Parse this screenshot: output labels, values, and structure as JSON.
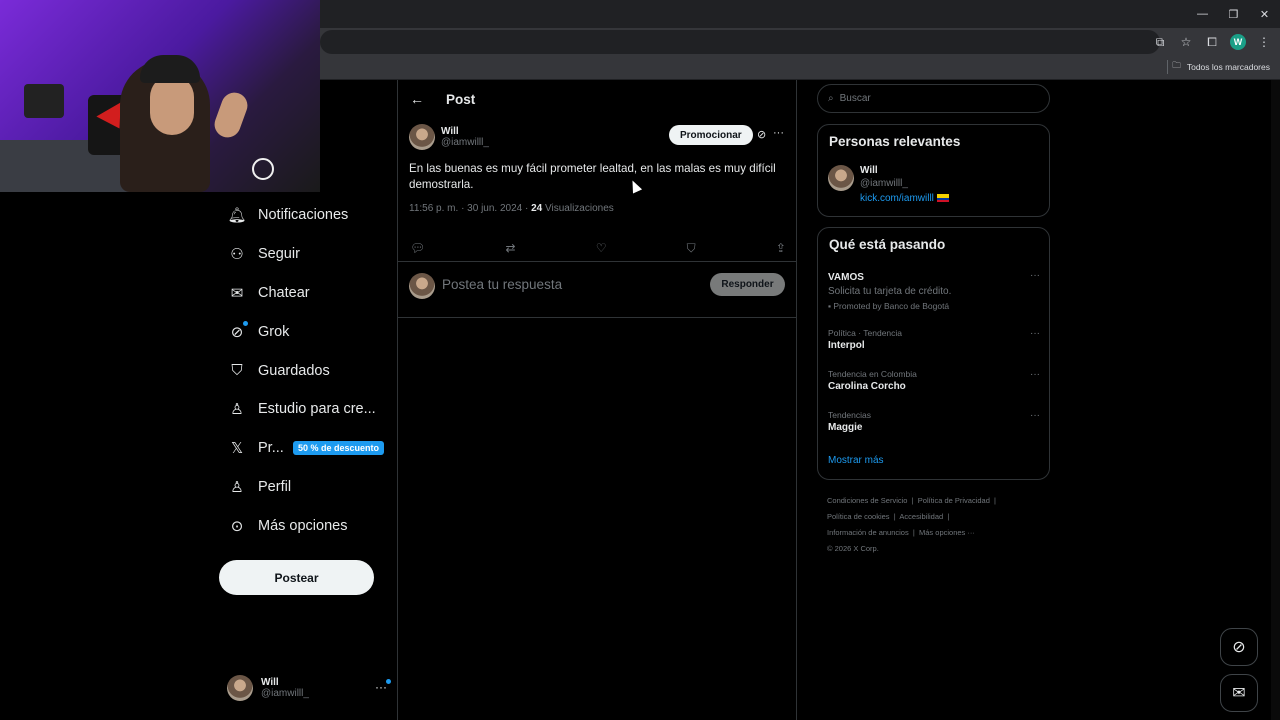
{
  "browser": {
    "profile_initial": "W",
    "bookmarks_all": "Todos los marcadores"
  },
  "nav": {
    "items": [
      {
        "label": "Notificaciones",
        "icon": "bell-icon"
      },
      {
        "label": "Seguir",
        "icon": "follow-icon"
      },
      {
        "label": "Chatear",
        "icon": "mail-icon"
      },
      {
        "label": "Grok",
        "icon": "grok-icon"
      },
      {
        "label": "Guardados",
        "icon": "bookmark-icon"
      },
      {
        "label": "Estudio para cre...",
        "icon": "studio-icon"
      },
      {
        "label": "Pr...",
        "icon": "x-logo-icon",
        "badge": "50 % de descuento"
      },
      {
        "label": "Perfil",
        "icon": "profile-icon"
      },
      {
        "label": "Más opciones",
        "icon": "more-icon"
      }
    ],
    "post_button": "Postear",
    "me": {
      "name": "Will",
      "handle": "@iamwilll_"
    }
  },
  "post": {
    "header": "Post",
    "author_name": "Will",
    "author_handle": "@iamwilll_",
    "promote_label": "Promocionar",
    "text": "En las buenas es muy fácil prometer lealtad, en las malas es muy difícil demostrarla.",
    "timestamp": "11:56 p. m. · 30 jun. 2024 · ",
    "views_count": "24",
    "views_label": " Visualizaciones",
    "reply_placeholder": "Postea tu respuesta",
    "reply_button": "Responder"
  },
  "sidebar": {
    "search_placeholder": "Buscar",
    "relevant": {
      "title": "Personas relevantes",
      "name": "Will",
      "handle": "@iamwilll_",
      "link": "kick.com/iamwilll"
    },
    "trends": {
      "title": "Qué está pasando",
      "items": [
        {
          "category": "",
          "name": "VAMOS",
          "desc": "Solicita tu tarjeta de crédito.",
          "promo": "Promoted by Banco de Bogotá"
        },
        {
          "category": "Política · Tendencia",
          "name": "Interpol"
        },
        {
          "category": "Tendencia en Colombia",
          "name": "Carolina Corcho"
        },
        {
          "category": "Tendencias",
          "name": "Maggie"
        }
      ],
      "show_more": "Mostrar más"
    },
    "footer": {
      "links": [
        "Condiciones de Servicio",
        "Política de Privacidad",
        "Política de cookies",
        "Accesibilidad",
        "Información de anuncios",
        "Más opciones ···"
      ],
      "copyright": "© 2026 X Corp."
    }
  },
  "colors": {
    "accent": "#1d9bf0",
    "background": "#000000",
    "border": "#2f3336",
    "muted": "#71767b"
  }
}
